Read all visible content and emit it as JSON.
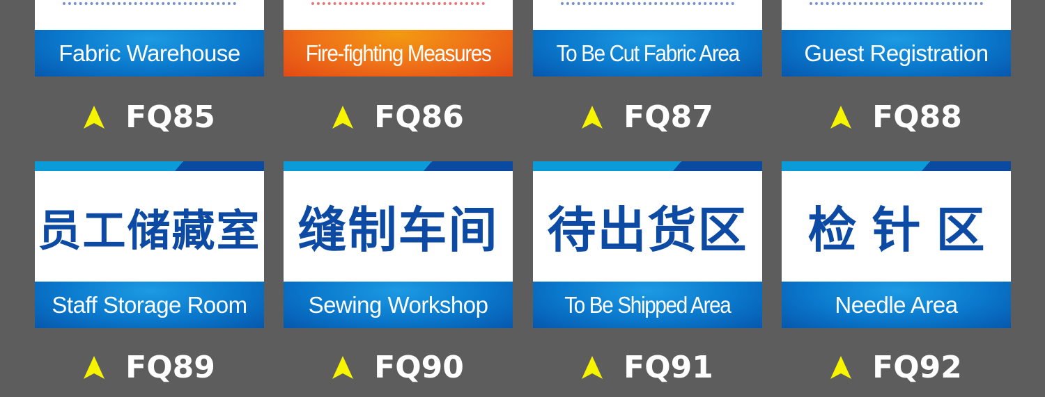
{
  "colors": {
    "background": "#5d5d5d",
    "sign_blue": "#0a78cc",
    "sign_dark_blue": "#0a4aa0",
    "stripe_light_blue": "#0b9bd8",
    "sign_orange": "#ef7218",
    "chinese_text_blue": "#0c4aa3",
    "arrow_yellow": "#f7f400"
  },
  "rows": [
    {
      "items": [
        {
          "code": "FQ85",
          "chinese": "",
          "english": "Fabric Warehouse",
          "theme": "blue"
        },
        {
          "code": "FQ86",
          "chinese": "",
          "english": "Fire-fighting Measures",
          "theme": "orange"
        },
        {
          "code": "FQ87",
          "chinese": "",
          "english": "To Be Cut Fabric Area",
          "theme": "blue"
        },
        {
          "code": "FQ88",
          "chinese": "",
          "english": "Guest Registration",
          "theme": "blue"
        }
      ]
    },
    {
      "items": [
        {
          "code": "FQ89",
          "chinese": "员工储藏室",
          "english": "Staff Storage Room",
          "theme": "blue"
        },
        {
          "code": "FQ90",
          "chinese": "缝制车间",
          "english": "Sewing Workshop",
          "theme": "blue"
        },
        {
          "code": "FQ91",
          "chinese": "待出货区",
          "english": "To Be Shipped Area",
          "theme": "blue"
        },
        {
          "code": "FQ92",
          "chinese": "检针区",
          "english": "Needle Area",
          "theme": "blue"
        }
      ]
    }
  ],
  "icons": {
    "code_marker": "yellow-arrow-up-icon"
  }
}
